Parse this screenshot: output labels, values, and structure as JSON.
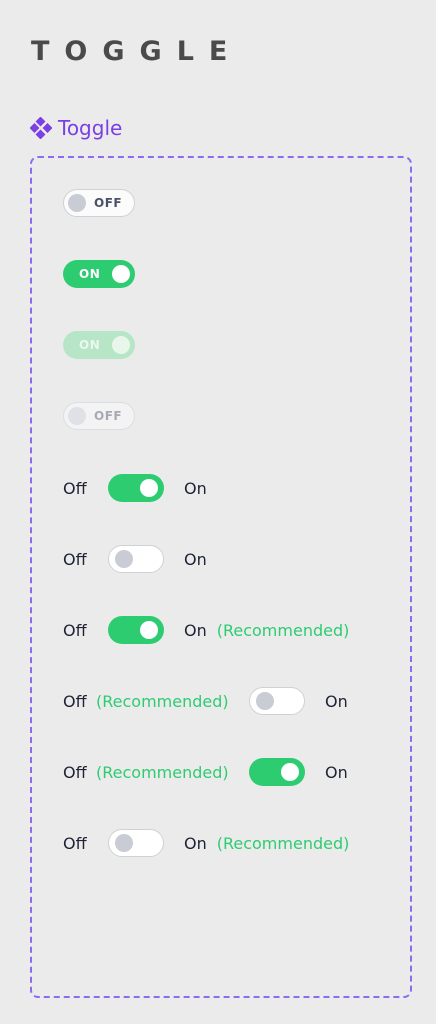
{
  "page": {
    "title": "TOGGLE"
  },
  "section": {
    "icon": "diamond-grid-icon",
    "label": "Toggle"
  },
  "colors": {
    "accent": "#7b3fe4",
    "on": "#2ecc71",
    "frame": "#8b6cf0",
    "text": "#1e2235"
  },
  "toggles": {
    "off_default": {
      "label": "OFF",
      "state": "off"
    },
    "on_default": {
      "label": "ON",
      "state": "on"
    },
    "on_disabled": {
      "label": "ON",
      "state": "on",
      "disabled": true
    },
    "off_disabled": {
      "label": "OFF",
      "state": "off",
      "disabled": true
    }
  },
  "switch_rows": [
    {
      "off_label": "Off",
      "on_label": "On",
      "state": "on"
    },
    {
      "off_label": "Off",
      "on_label": "On",
      "state": "off"
    },
    {
      "off_label": "Off",
      "on_label": "On",
      "state": "on",
      "recommended": "(Recommended)"
    },
    {
      "off_label": "Off",
      "off_recommended": "(Recommended)",
      "on_label": "On",
      "state": "off"
    },
    {
      "off_label": "Off",
      "off_recommended": "(Recommended)",
      "on_label": "On",
      "state": "on"
    },
    {
      "off_label": "Off",
      "on_label": "On",
      "state": "off",
      "recommended": "(Recommended)"
    }
  ]
}
